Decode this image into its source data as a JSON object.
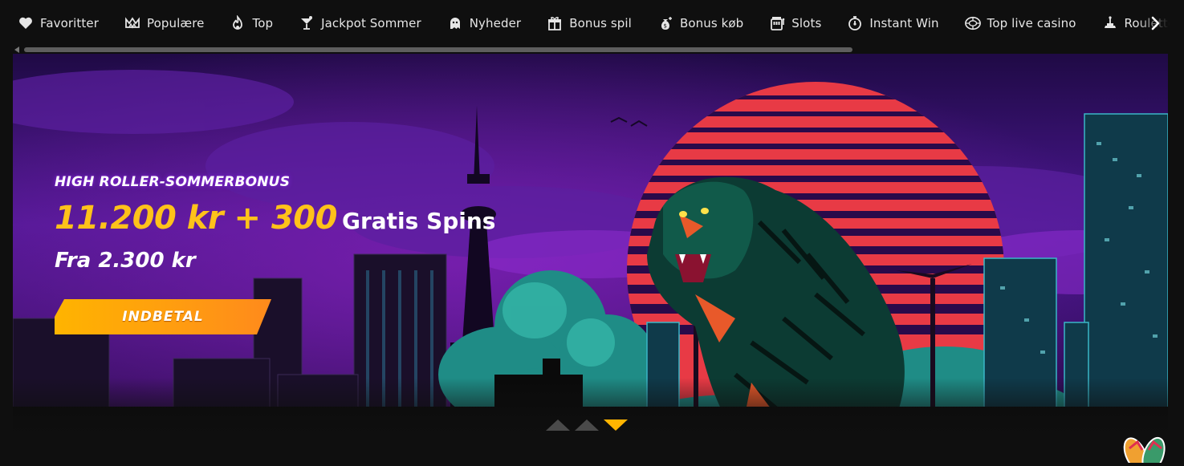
{
  "nav": {
    "items": [
      {
        "label": "Favoritter",
        "icon": "heart-icon"
      },
      {
        "label": "Populære",
        "icon": "crown-icon"
      },
      {
        "label": "Top",
        "icon": "flame-icon"
      },
      {
        "label": "Jackpot Sommer",
        "icon": "cocktail-icon"
      },
      {
        "label": "Nyheder",
        "icon": "ghost-icon"
      },
      {
        "label": "Bonus spil",
        "icon": "gift-icon"
      },
      {
        "label": "Bonus køb",
        "icon": "money-bag-icon"
      },
      {
        "label": "Slots",
        "icon": "slot-machine-icon"
      },
      {
        "label": "Instant Win",
        "icon": "stopwatch-icon"
      },
      {
        "label": "Top live casino",
        "icon": "poker-chip-icon"
      },
      {
        "label": "Roulette",
        "icon": "roulette-icon"
      }
    ],
    "next_icon": "chevron-right-icon"
  },
  "banner": {
    "eyebrow": "HIGH ROLLER-SOMMERBONUS",
    "amount": "11.200 kr + 300",
    "amount_suffix": "Gratis Spins",
    "subline": "Fra 2.300 kr",
    "cta_label": "INDBETAL",
    "slides_total": 3,
    "slide_active": 3
  },
  "colors": {
    "accent": "#ffc21a",
    "cta": "#ffa40c",
    "sky": "#4a1790",
    "sun": "#e83a45"
  }
}
